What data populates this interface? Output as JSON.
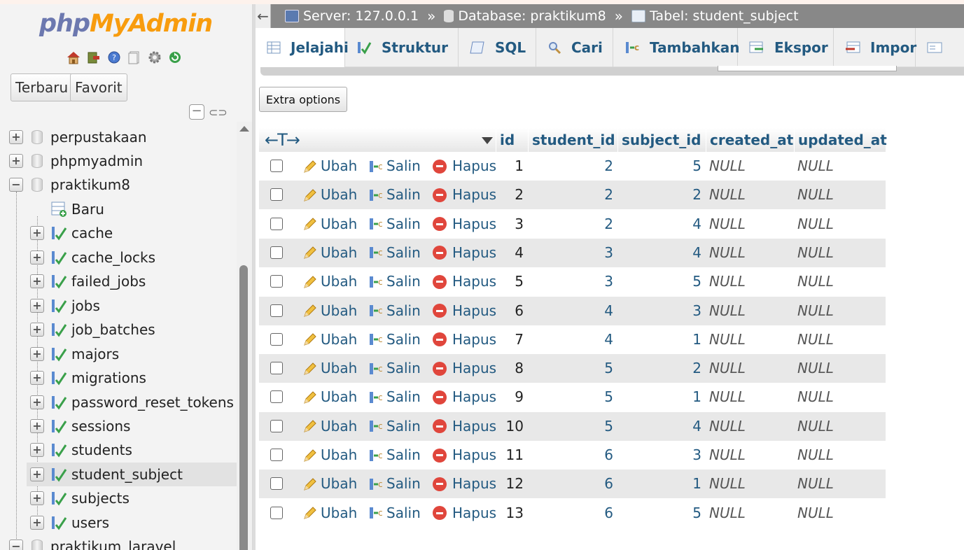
{
  "nav": {
    "logo_php": "php",
    "logo_myadmin": "MyAdmin",
    "icons": [
      "home-icon",
      "exit-icon",
      "help-icon",
      "docs-icon",
      "settings-icon",
      "reload-icon"
    ],
    "recent_tab": "Terbaru",
    "favorites_tab": "Favorit",
    "tree": [
      {
        "label": "perpustakaan",
        "type": "db",
        "expander": "+"
      },
      {
        "label": "phpmyadmin",
        "type": "db",
        "expander": "+"
      },
      {
        "label": "praktikum8",
        "type": "db",
        "expander": "−"
      },
      {
        "label": "Baru",
        "type": "new"
      },
      {
        "label": "cache",
        "type": "table"
      },
      {
        "label": "cache_locks",
        "type": "table"
      },
      {
        "label": "failed_jobs",
        "type": "table"
      },
      {
        "label": "jobs",
        "type": "table"
      },
      {
        "label": "job_batches",
        "type": "table"
      },
      {
        "label": "majors",
        "type": "table"
      },
      {
        "label": "migrations",
        "type": "table"
      },
      {
        "label": "password_reset_tokens",
        "type": "table"
      },
      {
        "label": "sessions",
        "type": "table"
      },
      {
        "label": "students",
        "type": "table"
      },
      {
        "label": "student_subject",
        "type": "table",
        "selected": true
      },
      {
        "label": "subjects",
        "type": "table"
      },
      {
        "label": "users",
        "type": "table"
      },
      {
        "label": "praktikum_laravel",
        "type": "db",
        "expander": "−"
      }
    ]
  },
  "breadcrumb": {
    "server": "Server: 127.0.0.1",
    "database": "Database: praktikum8",
    "table": "Tabel: student_subject",
    "separator": "»"
  },
  "tabs": [
    {
      "label": "Jelajahi",
      "active": true,
      "icon": "browse-icon"
    },
    {
      "label": "Struktur",
      "icon": "structure-icon"
    },
    {
      "label": "SQL",
      "icon": "sql-icon"
    },
    {
      "label": "Cari",
      "icon": "search-icon"
    },
    {
      "label": "Tambahkan",
      "icon": "insert-icon"
    },
    {
      "label": "Ekspor",
      "icon": "export-icon"
    },
    {
      "label": "Impor",
      "icon": "import-icon"
    },
    {
      "label": "",
      "icon": "more-icon"
    }
  ],
  "extra_options": "Extra options",
  "grid": {
    "sort_arrows": "←T→",
    "columns": [
      "id",
      "student_id",
      "subject_id",
      "created_at",
      "updated_at"
    ],
    "actions": {
      "edit": "Ubah",
      "copy": "Salin",
      "delete": "Hapus"
    },
    "rows": [
      {
        "id": "1",
        "student_id": "2",
        "subject_id": "5",
        "created_at": "NULL",
        "updated_at": "NULL"
      },
      {
        "id": "2",
        "student_id": "2",
        "subject_id": "2",
        "created_at": "NULL",
        "updated_at": "NULL"
      },
      {
        "id": "3",
        "student_id": "2",
        "subject_id": "4",
        "created_at": "NULL",
        "updated_at": "NULL"
      },
      {
        "id": "4",
        "student_id": "3",
        "subject_id": "4",
        "created_at": "NULL",
        "updated_at": "NULL"
      },
      {
        "id": "5",
        "student_id": "3",
        "subject_id": "5",
        "created_at": "NULL",
        "updated_at": "NULL"
      },
      {
        "id": "6",
        "student_id": "4",
        "subject_id": "3",
        "created_at": "NULL",
        "updated_at": "NULL"
      },
      {
        "id": "7",
        "student_id": "4",
        "subject_id": "1",
        "created_at": "NULL",
        "updated_at": "NULL"
      },
      {
        "id": "8",
        "student_id": "5",
        "subject_id": "2",
        "created_at": "NULL",
        "updated_at": "NULL"
      },
      {
        "id": "9",
        "student_id": "5",
        "subject_id": "1",
        "created_at": "NULL",
        "updated_at": "NULL"
      },
      {
        "id": "10",
        "student_id": "5",
        "subject_id": "4",
        "created_at": "NULL",
        "updated_at": "NULL"
      },
      {
        "id": "11",
        "student_id": "6",
        "subject_id": "3",
        "created_at": "NULL",
        "updated_at": "NULL"
      },
      {
        "id": "12",
        "student_id": "6",
        "subject_id": "1",
        "created_at": "NULL",
        "updated_at": "NULL"
      },
      {
        "id": "13",
        "student_id": "6",
        "subject_id": "5",
        "created_at": "NULL",
        "updated_at": "NULL"
      }
    ]
  }
}
